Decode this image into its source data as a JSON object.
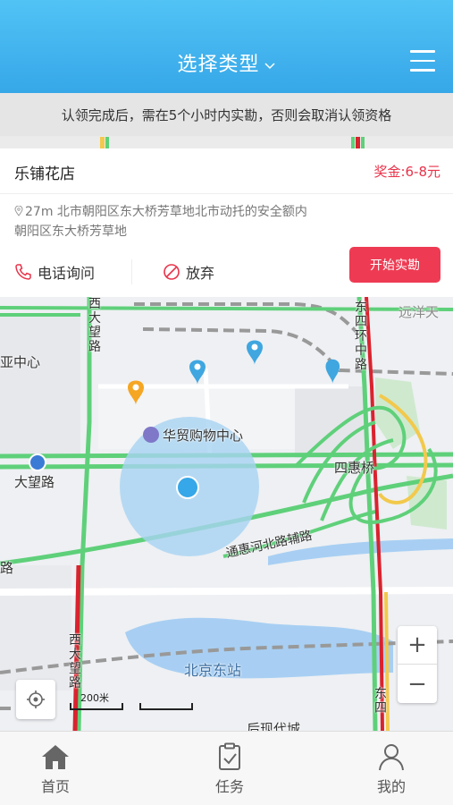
{
  "header": {
    "title": "选择类型",
    "menu_icon": "hamburger-icon"
  },
  "notice": "认领完成后，需在5个小时内实勘，否则会取消认领资格",
  "task": {
    "shop_name": "乐铺花店",
    "bonus": "奖金:6-8元",
    "address_line1": "27m 北市朝阳区东大桥芳草地北市动托的安全额内",
    "address_line2": "朝阳区东大桥芳草地",
    "phone_label": "电话询问",
    "giveup_label": "放弃",
    "start_label": "开始实勘"
  },
  "map": {
    "labels": {
      "yuanyang": "远洋天",
      "zhongxin": "亚中心",
      "huamao": "华贸购物中心",
      "dawang": "大望路",
      "sihui": "四惠桥",
      "tonghui": "通惠河北路辅路",
      "lu": "路",
      "beijingdong": "北京东站",
      "xiandai": "后现代城",
      "xidawanglu": "西大望路",
      "dongsihuan": "东四环中路",
      "xidawanglu2": "西大望路",
      "dongsi2": "东四"
    },
    "scale": "200米",
    "zoom_in": "+",
    "zoom_out": "−"
  },
  "tabs": [
    {
      "label": "首页",
      "icon": "home-icon"
    },
    {
      "label": "任务",
      "icon": "clipboard-icon"
    },
    {
      "label": "我的",
      "icon": "user-icon"
    }
  ],
  "colors": {
    "header": "#3fb2ee",
    "accent": "#ee3b53",
    "road_green": "#5fd07a",
    "road_red": "#d9232e",
    "road_yellow": "#f2c94c"
  }
}
